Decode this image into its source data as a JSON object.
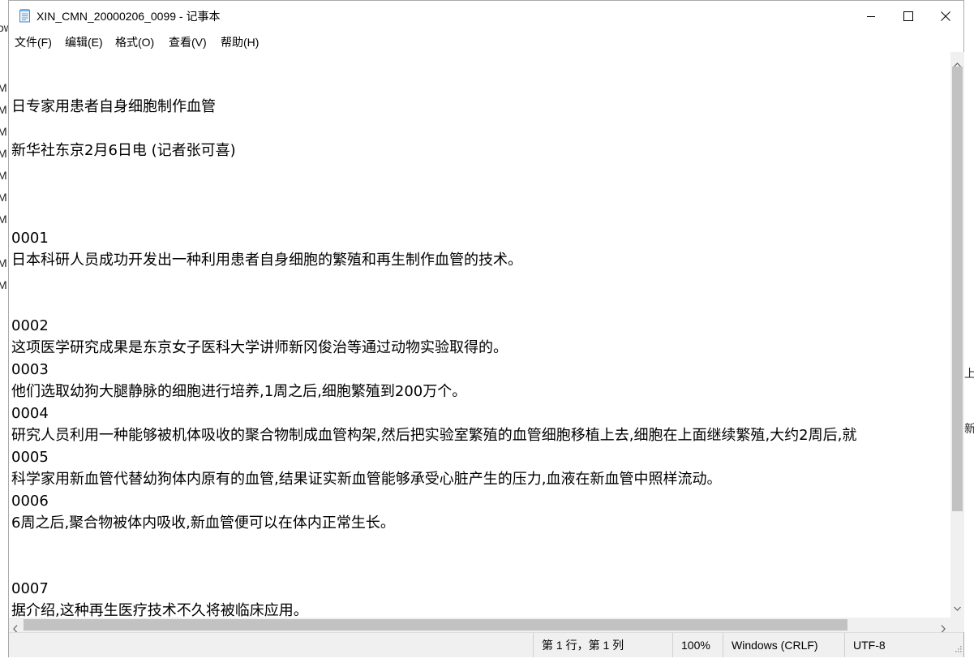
{
  "window": {
    "title": "XIN_CMN_20000206_0099 - 记事本",
    "icon": "notepad-icon"
  },
  "controls": {
    "minimize": "minimize-icon",
    "maximize": "maximize-icon",
    "close": "close-icon"
  },
  "menu": {
    "items": [
      "文件(F)",
      "编辑(E)",
      "格式(O)",
      "查看(V)",
      "帮助(H)"
    ]
  },
  "document": {
    "lines": [
      "",
      "",
      "日专家用患者自身细胞制作血管",
      "",
      "新华社东京2月6日电 (记者张可喜)",
      "",
      "",
      "",
      "0001",
      "日本科研人员成功开发出一种利用患者自身细胞的繁殖和再生制作血管的技术。",
      "",
      "",
      "0002",
      "这项医学研究成果是东京女子医科大学讲师新冈俊治等通过动物实验取得的。",
      "0003",
      "他们选取幼狗大腿静脉的细胞进行培养,1周之后,细胞繁殖到200万个。",
      "0004",
      "研究人员利用一种能够被机体吸收的聚合物制成血管构架,然后把实验室繁殖的血管细胞移植上去,细胞在上面继续繁殖,大约2周后,就",
      "0005",
      "科学家用新血管代替幼狗体内原有的血管,结果证实新血管能够承受心脏产生的压力,血液在新血管中照样流动。",
      "0006",
      "6周之后,聚合物被体内吸收,新血管便可以在体内正常生长。",
      "",
      "",
      "0007",
      "据介绍,这种再生医疗技术不久将被临床应用。"
    ]
  },
  "status": {
    "position": "第 1 行，第 1 列",
    "zoom": "100%",
    "line_ending": "Windows (CRLF)",
    "encoding": "UTF-8"
  },
  "background": {
    "left_fragments": [
      "ow",
      "M",
      "M",
      "M",
      "M",
      "M",
      "M",
      "M",
      "M",
      "M"
    ],
    "right_fragments": [
      "上",
      "新"
    ]
  }
}
